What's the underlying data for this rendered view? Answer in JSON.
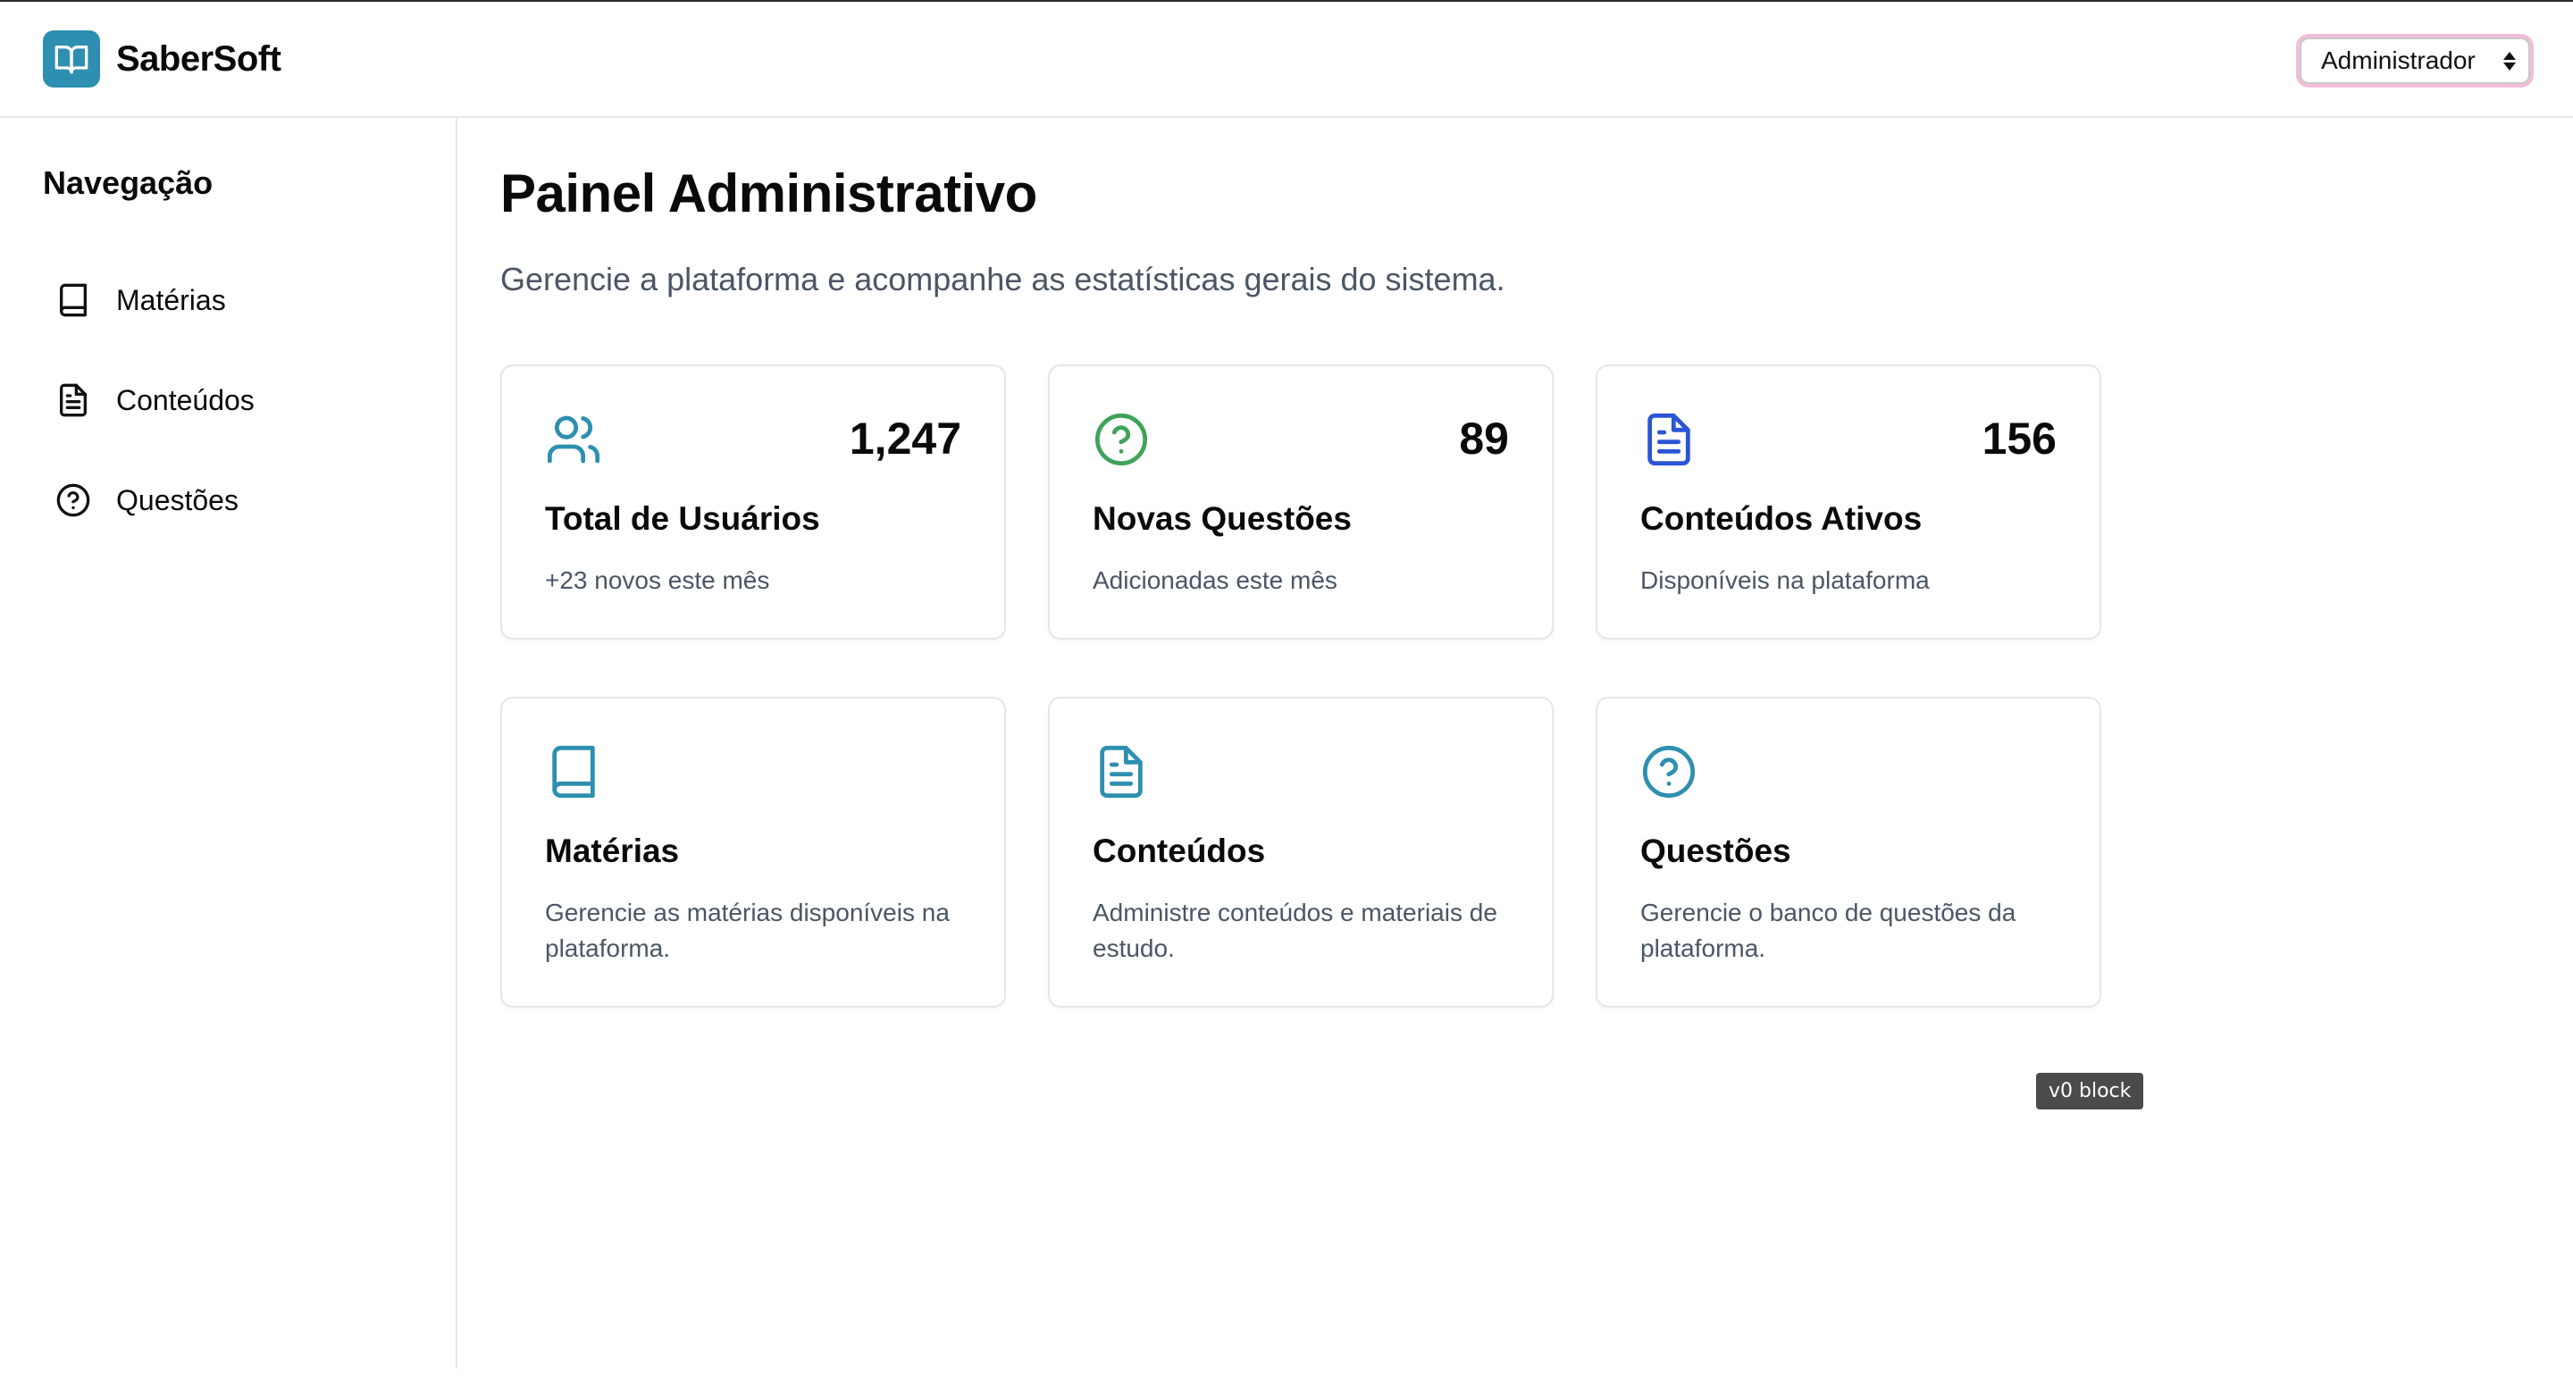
{
  "app": {
    "name": "SaberSoft"
  },
  "header": {
    "role_selected": "Administrador"
  },
  "sidebar": {
    "title": "Navegação",
    "items": [
      {
        "label": "Matérias",
        "icon": "book-icon"
      },
      {
        "label": "Conteúdos",
        "icon": "file-text-icon"
      },
      {
        "label": "Questões",
        "icon": "help-circle-icon"
      }
    ]
  },
  "main": {
    "title": "Painel Administrativo",
    "subtitle": "Gerencie a plataforma e acompanhe as estatísticas gerais do sistema.",
    "stats": [
      {
        "icon": "users-icon",
        "color": "#2e8fb0",
        "value": "1,247",
        "title": "Total de Usuários",
        "description": "+23 novos este mês"
      },
      {
        "icon": "help-circle-icon",
        "color": "#3ea35a",
        "value": "89",
        "title": "Novas Questões",
        "description": "Adicionadas este mês"
      },
      {
        "icon": "file-text-icon",
        "color": "#2a55d6",
        "value": "156",
        "title": "Conteúdos Ativos",
        "description": "Disponíveis na plataforma"
      }
    ],
    "sections": [
      {
        "icon": "book-icon",
        "color": "#2e8fb0",
        "title": "Matérias",
        "description": "Gerencie as matérias disponíveis na plataforma."
      },
      {
        "icon": "file-text-icon",
        "color": "#2e8fb0",
        "title": "Conteúdos",
        "description": "Administre conteúdos e materiais de estudo."
      },
      {
        "icon": "help-circle-icon",
        "color": "#2e8fb0",
        "title": "Questões",
        "description": "Gerencie o banco de questões da plataforma."
      }
    ]
  },
  "badge": {
    "label": "v0 block"
  },
  "colors": {
    "brand": "#2e8fb0",
    "focus_ring": "#f1bdd8",
    "border": "#e4e6ea",
    "muted_text": "#4b5565"
  }
}
